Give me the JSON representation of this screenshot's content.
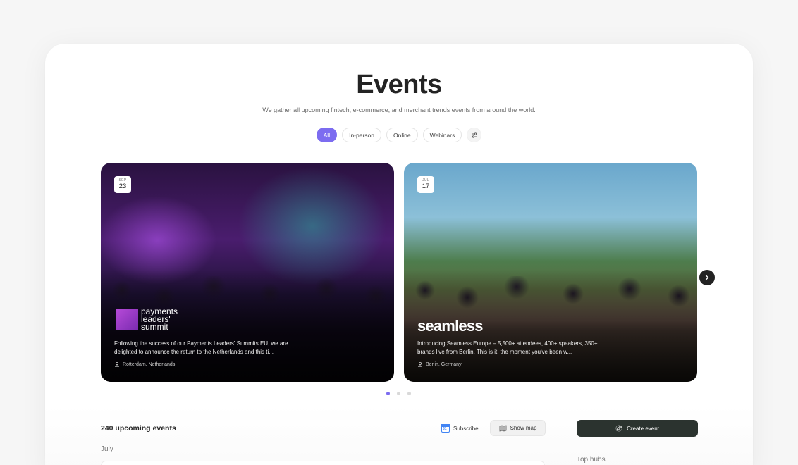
{
  "header": {
    "title": "Events",
    "subtitle": "We gather all upcoming fintech, e-commerce, and merchant trends events from around the world."
  },
  "filters": {
    "items": [
      "All",
      "In-person",
      "Online",
      "Webinars"
    ],
    "selected": "All",
    "settings_icon": "sliders-icon"
  },
  "featured": [
    {
      "month": "SEP",
      "day": "23",
      "logo_text": "payments leaders' summit",
      "description": "Following the success of our Payments Leaders' Summits EU, we are delighted to announce the return to the Netherlands and this ti...",
      "location": "Rotterdam, Netherlands"
    },
    {
      "month": "JUL",
      "day": "17",
      "logo_text": "seamless",
      "description": "Introducing Seamless Europe – 5,500+ attendees, 400+ speakers, 350+ brands live from Berlin. This is it, the moment you've been w...",
      "location": "Berlin, Germany"
    }
  ],
  "carousel": {
    "pages": 3,
    "current": 1
  },
  "list": {
    "count_label": "240 upcoming events",
    "month_label": "July",
    "subscribe_label": "Subscribe",
    "show_map_label": "Show map"
  },
  "sidebar": {
    "create_label": "Create event",
    "top_hubs_label": "Top hubs"
  },
  "colors": {
    "accent": "#7c6cf0",
    "dark_button": "#2b332f"
  }
}
